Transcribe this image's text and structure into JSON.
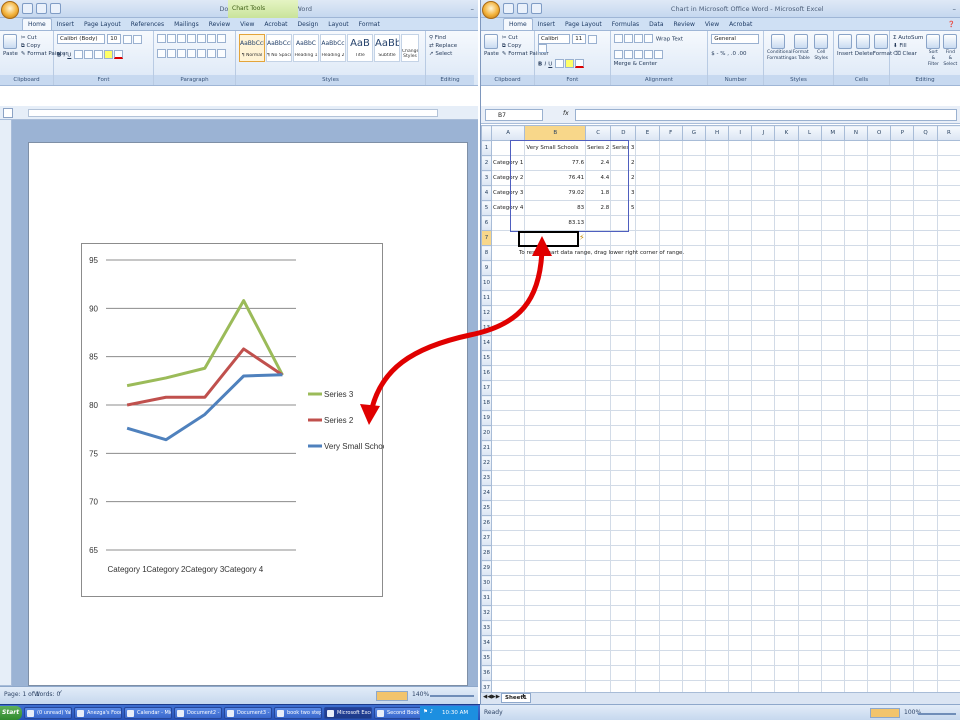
{
  "word": {
    "title": "Document2 - Microsoft Word",
    "context_tab": "Chart Tools",
    "tabs": [
      "Home",
      "Insert",
      "Page Layout",
      "References",
      "Mailings",
      "Review",
      "View",
      "Acrobat",
      "Design",
      "Layout",
      "Format"
    ],
    "clipboard": {
      "paste": "Paste",
      "cut": "Cut",
      "copy": "Copy",
      "format_painter": "Format Painter",
      "label": "Clipboard"
    },
    "font": {
      "name": "Calibri (Body)",
      "size": "10",
      "label": "Font"
    },
    "paragraph_label": "Paragraph",
    "styles": {
      "label": "Styles",
      "items": [
        {
          "sample": "AaBbCcDc",
          "name": "¶ Normal"
        },
        {
          "sample": "AaBbCcDc",
          "name": "¶ No Spaci..."
        },
        {
          "sample": "AaBbC",
          "name": "Heading 1"
        },
        {
          "sample": "AaBbCc",
          "name": "Heading 2"
        },
        {
          "sample": "AaB",
          "name": "Title"
        },
        {
          "sample": "AaBbCc",
          "name": "Subtitle"
        }
      ],
      "change": "Change Styles"
    },
    "editing": {
      "find": "Find",
      "replace": "Replace",
      "select": "Select",
      "label": "Editing"
    },
    "status": {
      "page": "Page: 1 of 1",
      "words": "Words: 0",
      "zoom": "140%"
    }
  },
  "chart": {
    "xaxis_label_color": "#333333"
  },
  "chart_data": {
    "type": "line",
    "categories": [
      "Category 1",
      "Category 2",
      "Category 3",
      "Category 4"
    ],
    "series": [
      {
        "name": "Series 3",
        "color": "#9bbb59",
        "values": [
          82.0,
          82.8,
          83.8,
          90.8,
          83.1
        ]
      },
      {
        "name": "Series 2",
        "color": "#c0504d",
        "values": [
          80.0,
          80.8,
          80.8,
          85.8,
          83.1
        ]
      },
      {
        "name": "Very Small Schools",
        "color": "#4f81bd",
        "values": [
          77.6,
          76.41,
          79.02,
          83,
          83.13
        ]
      }
    ],
    "yticks": [
      "95",
      "90",
      "85",
      "80",
      "75",
      "70",
      "65"
    ],
    "ylim": [
      65,
      95
    ],
    "grid": true,
    "legend": "right"
  },
  "excel": {
    "title": "Chart in Microsoft Office Word - Microsoft Excel",
    "tabs": [
      "Home",
      "Insert",
      "Page Layout",
      "Formulas",
      "Data",
      "Review",
      "View",
      "Acrobat"
    ],
    "font_name": "Calibri",
    "font_size": "11",
    "wrap_text": "Wrap Text",
    "merge_center": "Merge & Center",
    "number_format": "General",
    "groups": [
      "Clipboard",
      "Font",
      "Alignment",
      "Number",
      "Styles",
      "Cells",
      "Editing"
    ],
    "styles_buttons": [
      "Conditional Formatting",
      "Format as Table",
      "Cell Styles"
    ],
    "cells_buttons": [
      "Insert",
      "Delete",
      "Format"
    ],
    "editing_buttons": [
      "AutoSum",
      "Fill",
      "Clear",
      "Sort & Filter",
      "Find & Select"
    ],
    "name_box": "B7",
    "fx": "fx",
    "columns": [
      "A",
      "B",
      "C",
      "D",
      "E",
      "F",
      "G",
      "H",
      "I",
      "J",
      "K",
      "L",
      "M",
      "N",
      "O",
      "P",
      "Q",
      "R"
    ],
    "rows": [
      [
        "",
        "Very Small Schools",
        "Series 2",
        "Series 3"
      ],
      [
        "Category 1",
        "77.6",
        "2.4",
        "2"
      ],
      [
        "Category 2",
        "76.41",
        "4.4",
        "2"
      ],
      [
        "Category 3",
        "79.02",
        "1.8",
        "3"
      ],
      [
        "Category 4",
        "83",
        "2.8",
        "5"
      ],
      [
        "",
        "83.13",
        "",
        ""
      ]
    ],
    "hint": "To resize chart data range, drag lower right corner of range.",
    "row_count": 37,
    "sheet_tab": "Sheet1",
    "status": "Ready",
    "zoom": "100%"
  },
  "taskbar": {
    "start": "Start",
    "items": [
      "(0 unread) Yahoo! ...",
      "Anezga's Food Dia...",
      "Calendar - Microsof...",
      "Document2 - Micro...",
      "Document3 - Micro...",
      "book two steps_for...",
      "Microsoft Excel - ...",
      "Second Book"
    ],
    "clock": "10:30 AM"
  }
}
